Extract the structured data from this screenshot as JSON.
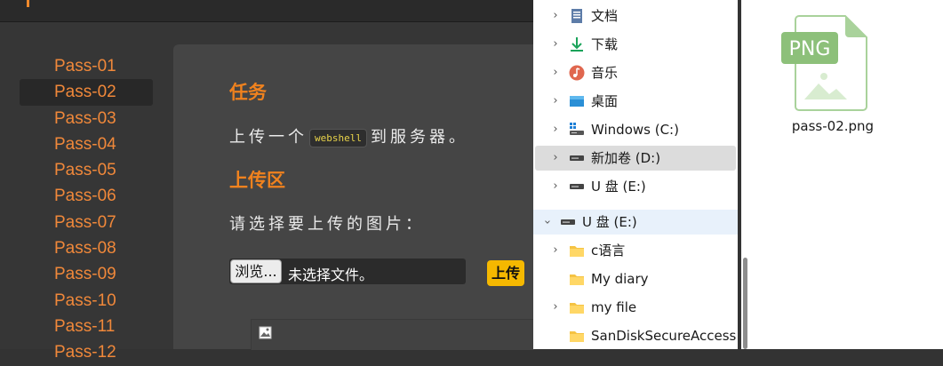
{
  "sidebar": {
    "items": [
      "Pass-01",
      "Pass-02",
      "Pass-03",
      "Pass-04",
      "Pass-05",
      "Pass-06",
      "Pass-07",
      "Pass-08",
      "Pass-09",
      "Pass-10",
      "Pass-11",
      "Pass-12"
    ],
    "active": "Pass-02"
  },
  "task": {
    "heading": "任务",
    "text_before": "上传一个",
    "code": "webshell",
    "text_after": "到服务器。"
  },
  "upload": {
    "heading": "上传区",
    "prompt": "请选择要上传的图片：",
    "browse_label": "浏览...",
    "no_file_label": "未选择文件。",
    "submit_label": "上传"
  },
  "explorer": {
    "items": [
      {
        "label": "文档",
        "icon": "documents-icon"
      },
      {
        "label": "下载",
        "icon": "download-icon"
      },
      {
        "label": "音乐",
        "icon": "music-icon"
      },
      {
        "label": "桌面",
        "icon": "desktop-icon"
      },
      {
        "label": "Windows (C:)",
        "icon": "drive-icon"
      },
      {
        "label": "新加卷 (D:)",
        "icon": "drive-icon"
      },
      {
        "label": "U 盘 (E:)",
        "icon": "drive-icon"
      },
      {
        "label": "U 盘 (E:)",
        "icon": "drive-icon"
      },
      {
        "label": "c语言",
        "icon": "folder-icon"
      },
      {
        "label": "My  diary",
        "icon": "folder-icon"
      },
      {
        "label": "my  file",
        "icon": "folder-icon"
      },
      {
        "label": "SanDiskSecureAccess",
        "icon": "folder-icon"
      }
    ]
  },
  "file": {
    "badge": "PNG",
    "name": "pass-02.png"
  },
  "colors": {
    "accent": "#f0883a",
    "heading": "#f0821e",
    "upload_button": "#f5b800",
    "png_green": "#8dc07a"
  }
}
